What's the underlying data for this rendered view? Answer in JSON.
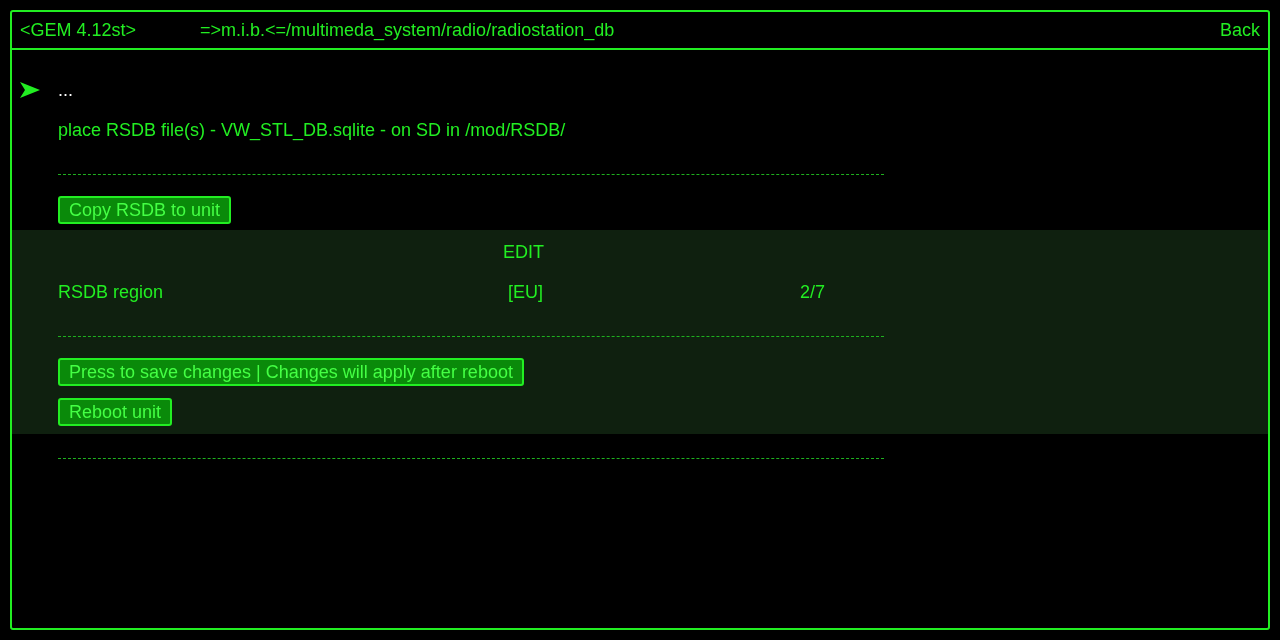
{
  "header": {
    "title": "<GEM 4.12st>",
    "path": "=>m.i.b.<=/multimeda_system/radio/radiostation_db",
    "back": "Back"
  },
  "sections": [
    {
      "highlighted": false,
      "items": [
        {
          "kind": "parent",
          "text": "...",
          "selected": true
        },
        {
          "kind": "text",
          "text": "place RSDB file(s) - VW_STL_DB.sqlite - on SD in /mod/RSDB/",
          "selected": false
        },
        {
          "kind": "separator"
        },
        {
          "kind": "button",
          "text": "Copy RSDB to unit",
          "selected": false
        }
      ]
    },
    {
      "highlighted": true,
      "items": [
        {
          "kind": "heading",
          "text": "EDIT",
          "selected": false
        },
        {
          "kind": "setting",
          "text": "RSDB region",
          "value": "[EU]",
          "index": "2/7",
          "selected": false
        },
        {
          "kind": "separator"
        },
        {
          "kind": "button",
          "text": "Press to save changes | Changes will apply after reboot",
          "selected": false
        },
        {
          "kind": "button",
          "text": "Reboot unit",
          "selected": false
        }
      ]
    },
    {
      "highlighted": false,
      "items": [
        {
          "kind": "separator"
        }
      ]
    }
  ]
}
